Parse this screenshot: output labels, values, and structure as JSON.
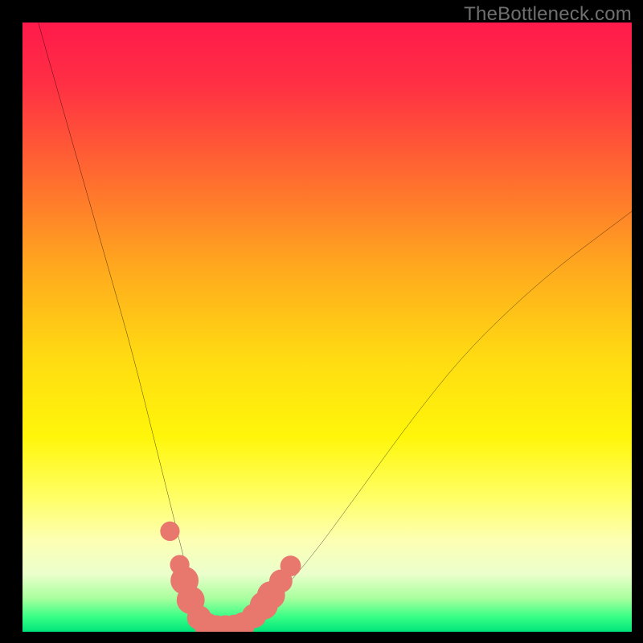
{
  "watermark": "TheBottleneck.com",
  "chart_data": {
    "type": "line",
    "title": "",
    "xlabel": "",
    "ylabel": "",
    "xlim": [
      0,
      100
    ],
    "ylim": [
      0,
      100
    ],
    "grid": false,
    "legend": false,
    "gradient_bands": [
      {
        "stop": 0.0,
        "color": "#ff1a4b"
      },
      {
        "stop": 0.1,
        "color": "#ff2f44"
      },
      {
        "stop": 0.25,
        "color": "#ff6a30"
      },
      {
        "stop": 0.4,
        "color": "#ffa81e"
      },
      {
        "stop": 0.55,
        "color": "#ffdb12"
      },
      {
        "stop": 0.68,
        "color": "#fff60a"
      },
      {
        "stop": 0.78,
        "color": "#ffff66"
      },
      {
        "stop": 0.85,
        "color": "#fdffb3"
      },
      {
        "stop": 0.905,
        "color": "#ebffcc"
      },
      {
        "stop": 0.945,
        "color": "#a9ff9e"
      },
      {
        "stop": 0.975,
        "color": "#3aff86"
      },
      {
        "stop": 1.0,
        "color": "#00e57a"
      }
    ],
    "series": [
      {
        "name": "bottleneck-curve",
        "color": "#000000",
        "x": [
          0,
          2,
          6,
          10,
          14,
          18,
          22,
          24,
          26,
          27.5,
          29,
          30.5,
          32,
          34,
          36,
          38,
          42,
          48,
          56,
          64,
          72,
          80,
          88,
          96,
          100
        ],
        "y": [
          110,
          102,
          88,
          74,
          60,
          46,
          30,
          22,
          14,
          8,
          4,
          1.5,
          0.5,
          0.5,
          1,
          2.5,
          6,
          13,
          24,
          35,
          45,
          53,
          60,
          66,
          69
        ]
      }
    ],
    "markers": {
      "name": "highlight-dots",
      "color": "#e8776e",
      "points": [
        {
          "x": 24.2,
          "y": 16.5,
          "r": 1.6
        },
        {
          "x": 25.8,
          "y": 11.0,
          "r": 1.6
        },
        {
          "x": 26.6,
          "y": 8.4,
          "r": 2.3
        },
        {
          "x": 27.6,
          "y": 5.2,
          "r": 2.3
        },
        {
          "x": 29.0,
          "y": 2.3,
          "r": 2.0
        },
        {
          "x": 30.3,
          "y": 1.0,
          "r": 2.1
        },
        {
          "x": 31.8,
          "y": 0.6,
          "r": 2.1
        },
        {
          "x": 33.3,
          "y": 0.6,
          "r": 2.1
        },
        {
          "x": 34.8,
          "y": 0.7,
          "r": 2.1
        },
        {
          "x": 36.2,
          "y": 1.2,
          "r": 2.0
        },
        {
          "x": 38.0,
          "y": 2.6,
          "r": 2.0
        },
        {
          "x": 39.6,
          "y": 4.3,
          "r": 2.3
        },
        {
          "x": 40.8,
          "y": 6.0,
          "r": 2.3
        },
        {
          "x": 42.4,
          "y": 8.3,
          "r": 1.9
        },
        {
          "x": 44.0,
          "y": 10.8,
          "r": 1.7
        }
      ]
    }
  }
}
